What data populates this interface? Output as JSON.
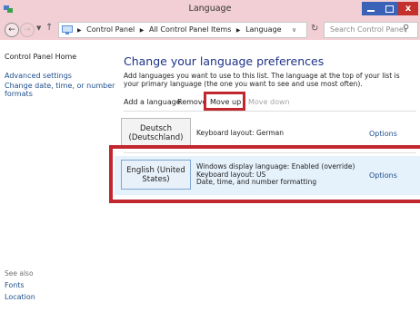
{
  "window": {
    "title": "Language"
  },
  "controls": {
    "close": "x"
  },
  "address_bar": {
    "breadcrumbs": [
      "Control Panel",
      "All Control Panel Items",
      "Language"
    ],
    "search_placeholder": "Search Control Panel"
  },
  "sidebar": {
    "home": "Control Panel Home",
    "links": [
      "Advanced settings",
      "Change date, time, or number formats"
    ],
    "see_also_heading": "See also",
    "see_also_links": [
      "Fonts",
      "Location"
    ]
  },
  "main": {
    "heading": "Change your language preferences",
    "description": "Add languages you want to use to this list. The language at the top of your list is your primary language (the one you want to see and use most often).",
    "toolbar": {
      "add": "Add a language",
      "remove": "Remove",
      "move_up": "Move up",
      "move_down": "Move down"
    },
    "languages": [
      {
        "name_line1": "Deutsch",
        "name_line2": "(Deutschland)",
        "info": [
          "Keyboard layout: German"
        ],
        "options": "Options"
      },
      {
        "name_line1": "English (United",
        "name_line2": "States)",
        "info": [
          "Windows display language: Enabled (override)",
          "Keyboard layout: US",
          "Date, time, and number formatting"
        ],
        "options": "Options"
      }
    ]
  },
  "colors": {
    "chrome": "#f2cfd5",
    "highlight": "#c1272d",
    "link": "#1e4e8c",
    "heading": "#1e3287"
  }
}
